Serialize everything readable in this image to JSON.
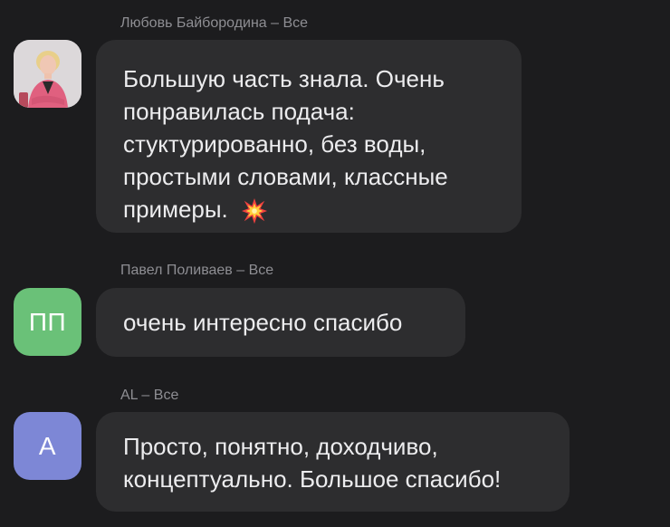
{
  "messages": [
    {
      "sender_line": "Любовь Байбородина – Все",
      "avatar": {
        "type": "photo",
        "icon": "user-photo-icon"
      },
      "text": "Большую часть знала. Очень понравилась подача: стуктурированно, без воды, простыми словами, классные примеры.",
      "emoji": "collision-icon"
    },
    {
      "sender_line": "Павел Поливаев – Все",
      "avatar": {
        "type": "initials",
        "initials": "ПП",
        "color": "#6ac178"
      },
      "text": "очень интересно спасибо"
    },
    {
      "sender_line": "AL – Все",
      "avatar": {
        "type": "initials",
        "initials": "А",
        "color": "#7d87d6"
      },
      "text": "Просто, понятно, доходчиво, концептуально. Большое спасибо!"
    }
  ],
  "colors": {
    "background": "#1c1c1e",
    "bubble": "#2d2d2f",
    "text": "#ececee",
    "sender": "#8e8e93"
  }
}
